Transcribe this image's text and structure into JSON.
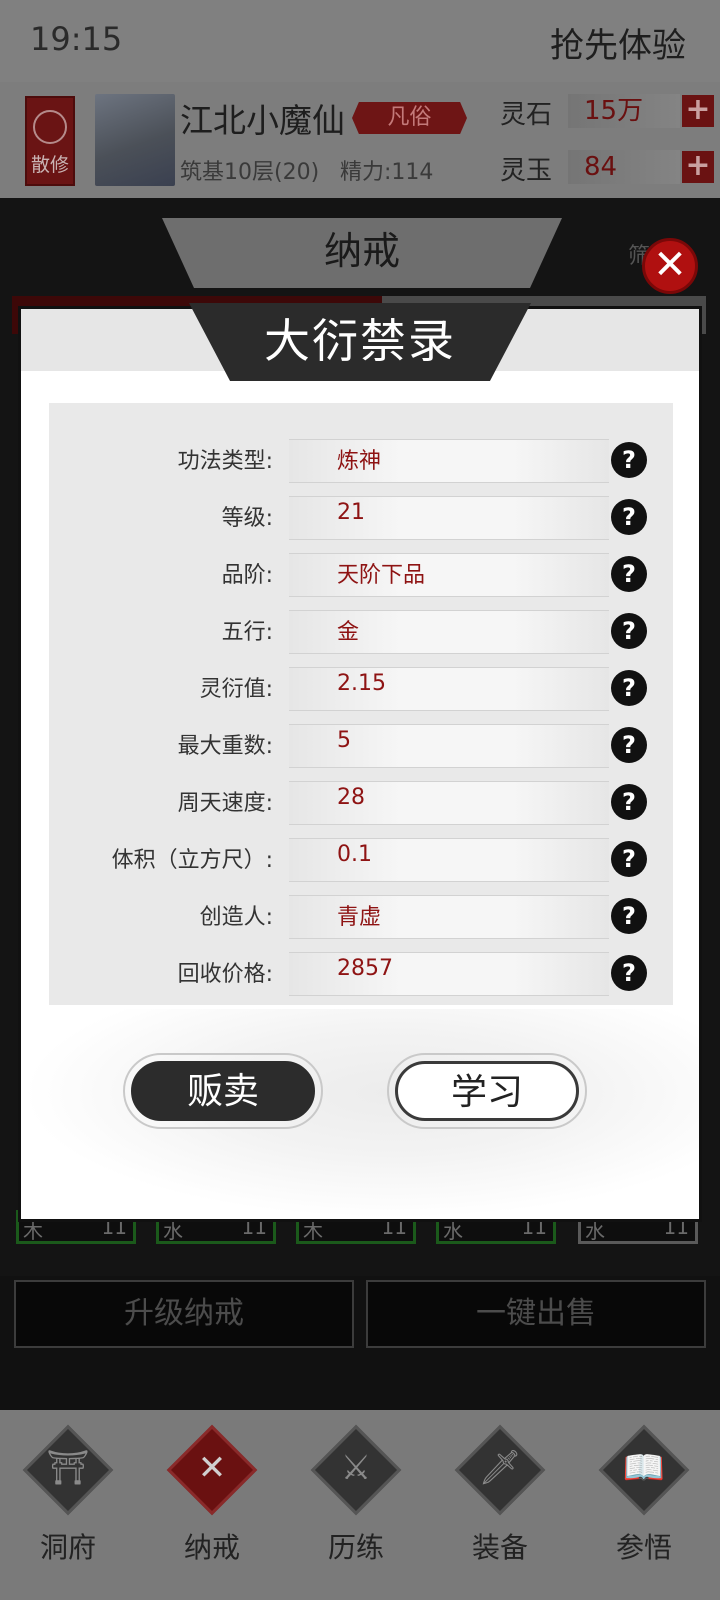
{
  "status_bar": {
    "time": "19:15",
    "right_text": "抢先体验"
  },
  "player": {
    "sect_badge": "散修",
    "name": "江北小魔仙",
    "rank": "凡俗",
    "realm": "筑基10层(20)",
    "energy": "精力:114"
  },
  "resources": [
    {
      "label": "灵石",
      "value": "15万",
      "plus": "+"
    },
    {
      "label": "灵玉",
      "value": "84",
      "plus": "+"
    }
  ],
  "bag": {
    "tab_title": "纳戒",
    "filter_label": "筛",
    "slots": [
      {
        "element": "木",
        "count": "11"
      },
      {
        "element": "水",
        "count": "11"
      },
      {
        "element": "木",
        "count": "11"
      },
      {
        "element": "水",
        "count": "11"
      },
      {
        "element": "水",
        "count": "11"
      }
    ],
    "upgrade_button": "升级纳戒",
    "sell_all_button": "一键出售"
  },
  "modal": {
    "title": "大衍禁录",
    "close_symbol": "✕",
    "help_symbol": "?",
    "rows": [
      {
        "label": "功法类型:",
        "value": "炼神"
      },
      {
        "label": "等级:",
        "value": "21"
      },
      {
        "label": "品阶:",
        "value": "天阶下品"
      },
      {
        "label": "五行:",
        "value": "金"
      },
      {
        "label": "灵衍值:",
        "value": "2.15"
      },
      {
        "label": "最大重数:",
        "value": "5"
      },
      {
        "label": "周天速度:",
        "value": "28"
      },
      {
        "label": "体积（立方尺）:",
        "value": "0.1"
      },
      {
        "label": "创造人:",
        "value": "青虚"
      },
      {
        "label": "回收价格:",
        "value": "2857"
      }
    ],
    "sell_button": "贩卖",
    "learn_button": "学习"
  },
  "nav": [
    {
      "label": "洞府",
      "glyph": "⛩",
      "icon": "cave-icon",
      "active": false
    },
    {
      "label": "纳戒",
      "glyph": "✕",
      "icon": "ring-icon",
      "active": true
    },
    {
      "label": "历练",
      "glyph": "⚔",
      "icon": "swords-icon",
      "active": false
    },
    {
      "label": "装备",
      "glyph": "🗡",
      "icon": "dagger-icon",
      "active": false
    },
    {
      "label": "参悟",
      "glyph": "📖",
      "icon": "book-icon",
      "active": false
    }
  ]
}
